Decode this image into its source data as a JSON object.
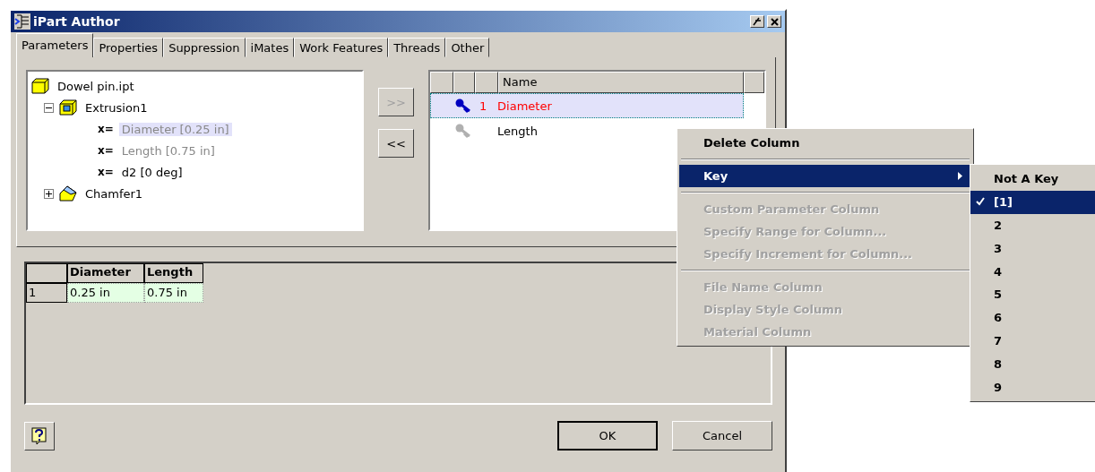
{
  "window": {
    "title": "iPart Author"
  },
  "tabs": [
    {
      "label": "Parameters",
      "selected": true
    },
    {
      "label": "Properties",
      "selected": false
    },
    {
      "label": "Suppression",
      "selected": false
    },
    {
      "label": "iMates",
      "selected": false
    },
    {
      "label": "Work Features",
      "selected": false
    },
    {
      "label": "Threads",
      "selected": false
    },
    {
      "label": "Other",
      "selected": false
    }
  ],
  "tree": [
    {
      "kind": "part",
      "label": "Dowel pin.ipt",
      "children": [
        {
          "kind": "feature",
          "label": "Extrusion1",
          "expanded": true,
          "children": [
            {
              "kind": "parameter",
              "symbol": "x=",
              "label": "Diameter [0.25 in]",
              "selected": true,
              "disabled": true
            },
            {
              "kind": "parameter",
              "symbol": "x=",
              "label": "Length [0.75 in]",
              "selected": false,
              "disabled": true
            },
            {
              "kind": "parameter",
              "symbol": "x=",
              "label": "d2 [0 deg]",
              "selected": false,
              "disabled": false
            }
          ]
        },
        {
          "kind": "chamfer",
          "label": "Chamfer1",
          "expanded": false
        }
      ]
    }
  ],
  "move_buttons": [
    {
      "label": ">>",
      "disabled": true
    },
    {
      "label": "<<",
      "disabled": false
    }
  ],
  "columns_list": {
    "header": "Name",
    "rows": [
      {
        "key": "1",
        "name": "Diameter",
        "keyed": true,
        "selected": true
      },
      {
        "name": "Length",
        "keyed": false,
        "selected": false
      }
    ]
  },
  "table": {
    "columns": [
      "Diameter",
      "Length"
    ],
    "rows": [
      {
        "label": "1",
        "cells": [
          "0.25 in",
          "0.75 in"
        ]
      }
    ]
  },
  "buttons": [
    "OK",
    "Cancel"
  ],
  "context_menu": [
    {
      "kind": "item",
      "label": "Delete Column",
      "bold": true,
      "disabled": false,
      "selected": false
    },
    {
      "kind": "separator"
    },
    {
      "kind": "submenu",
      "label": "Key",
      "bold": true,
      "disabled": false,
      "selected": true
    },
    {
      "kind": "separator"
    },
    {
      "kind": "item",
      "label": "Custom Parameter Column",
      "bold": true,
      "disabled": true,
      "selected": false
    },
    {
      "kind": "item",
      "label": "Specify Range for Column...",
      "bold": true,
      "disabled": true,
      "selected": false
    },
    {
      "kind": "item",
      "label": "Specify Increment for Column...",
      "bold": true,
      "disabled": true,
      "selected": false
    },
    {
      "kind": "separator"
    },
    {
      "kind": "item",
      "label": "File Name Column",
      "bold": true,
      "disabled": true,
      "selected": false
    },
    {
      "kind": "item",
      "label": "Display Style Column",
      "bold": true,
      "disabled": true,
      "selected": false
    },
    {
      "kind": "item",
      "label": "Material Column",
      "bold": true,
      "disabled": true,
      "selected": false
    }
  ],
  "submenu": [
    {
      "label": "Not A Key",
      "checked": false,
      "selected": false
    },
    {
      "label": "[1]",
      "checked": true,
      "selected": true
    },
    {
      "label": "2",
      "checked": false,
      "selected": false
    },
    {
      "label": "3",
      "checked": false,
      "selected": false
    },
    {
      "label": "4",
      "checked": false,
      "selected": false
    },
    {
      "label": "5",
      "checked": false,
      "selected": false
    },
    {
      "label": "6",
      "checked": false,
      "selected": false
    },
    {
      "label": "7",
      "checked": false,
      "selected": false
    },
    {
      "label": "8",
      "checked": false,
      "selected": false
    },
    {
      "label": "9",
      "checked": false,
      "selected": false
    }
  ]
}
